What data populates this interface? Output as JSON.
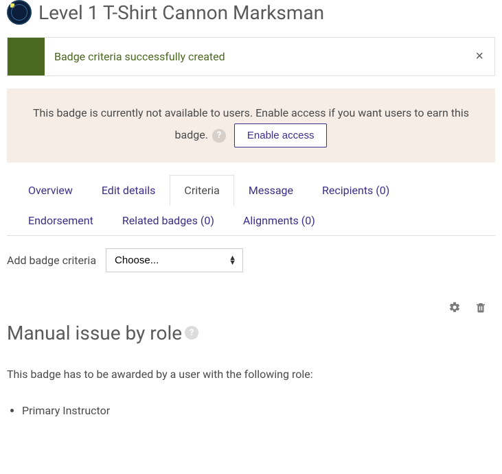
{
  "header": {
    "title": "Level 1 T-Shirt Cannon Marksman"
  },
  "alert_success": {
    "message": "Badge criteria successfully created"
  },
  "alert_info": {
    "text_before": "This badge is currently not available to users. Enable access if you want users to earn this badge.",
    "button_label": "Enable access"
  },
  "tabs": [
    {
      "label": "Overview",
      "active": false
    },
    {
      "label": "Edit details",
      "active": false
    },
    {
      "label": "Criteria",
      "active": true
    },
    {
      "label": "Message",
      "active": false
    },
    {
      "label": "Recipients (0)",
      "active": false
    },
    {
      "label": "Endorsement",
      "active": false
    },
    {
      "label": "Related badges (0)",
      "active": false
    },
    {
      "label": "Alignments (0)",
      "active": false
    }
  ],
  "criteria_form": {
    "label": "Add badge criteria",
    "selected": "Choose..."
  },
  "section": {
    "title": "Manual issue by role",
    "description": "This badge has to be awarded by a user with the following role:",
    "roles": [
      "Primary Instructor"
    ]
  }
}
